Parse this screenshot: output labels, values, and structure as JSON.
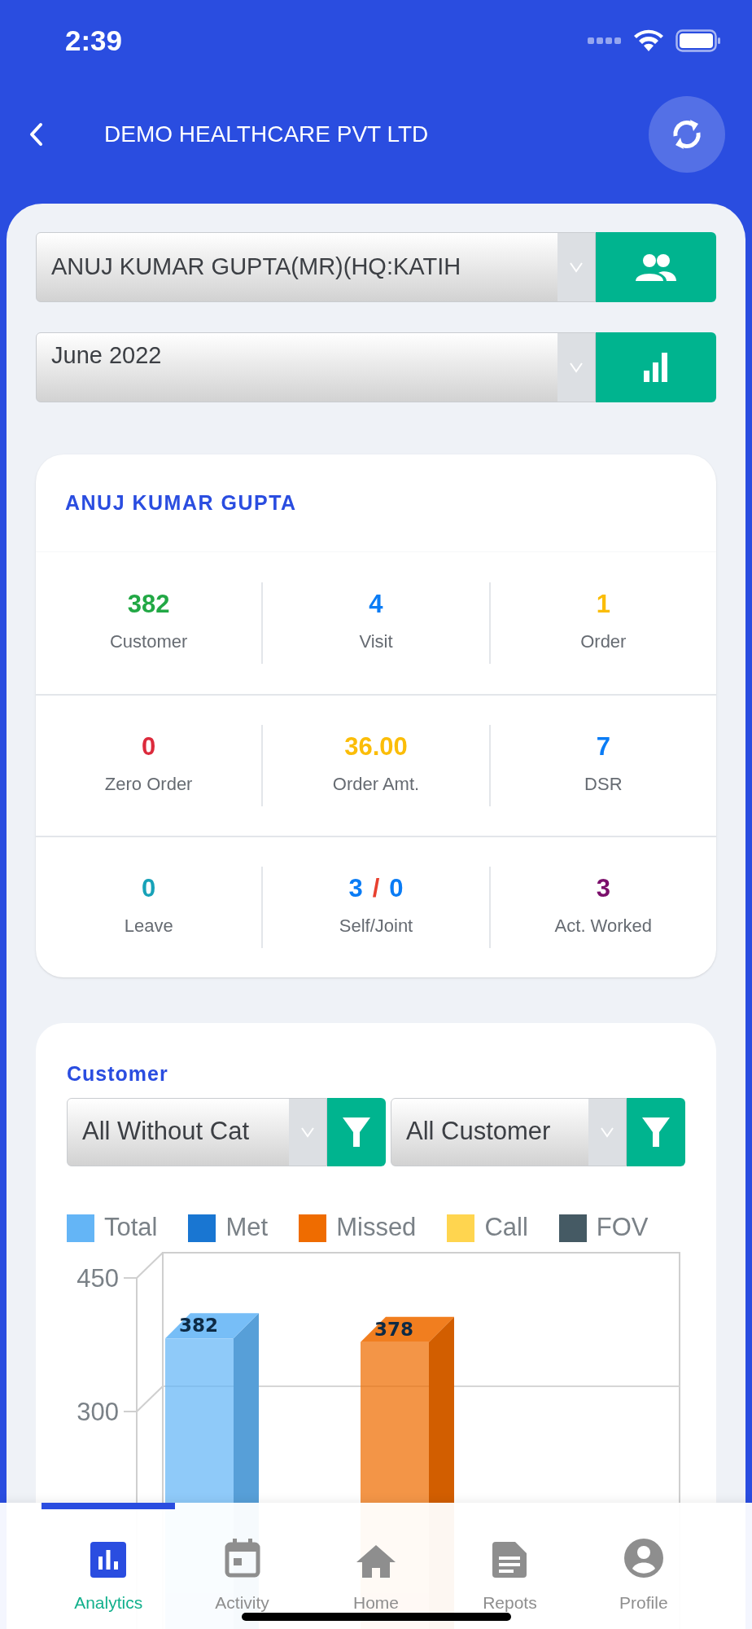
{
  "status_bar": {
    "time": "2:39"
  },
  "header": {
    "title": "DEMO HEALTHCARE PVT LTD"
  },
  "selectors": [
    {
      "value": "ANUJ KUMAR GUPTA(MR)(HQ:KATIH"
    },
    {
      "value": "June 2022"
    }
  ],
  "summary_card": {
    "title": "ANUJ KUMAR GUPTA",
    "rows": [
      [
        {
          "parts": [
            {
              "text": "382",
              "color": "#22a845"
            }
          ],
          "label": "Customer"
        },
        {
          "parts": [
            {
              "text": "4",
              "color": "#0a7cf5"
            }
          ],
          "label": "Visit"
        },
        {
          "parts": [
            {
              "text": "1",
              "color": "#fbbd08"
            }
          ],
          "label": "Order"
        }
      ],
      [
        {
          "parts": [
            {
              "text": "0",
              "color": "#dc2a3c"
            }
          ],
          "label": "Zero Order"
        },
        {
          "parts": [
            {
              "text": "36.00",
              "color": "#fbbd08"
            }
          ],
          "label": "Order Amt."
        },
        {
          "parts": [
            {
              "text": "7",
              "color": "#0a7cf5"
            }
          ],
          "label": "DSR"
        }
      ],
      [
        {
          "parts": [
            {
              "text": "0",
              "color": "#17a2b8"
            }
          ],
          "label": "Leave"
        },
        {
          "parts": [
            {
              "text": "3",
              "color": "#0a7cf5"
            },
            {
              "text": "/",
              "color": "#e8402f"
            },
            {
              "text": "0",
              "color": "#0a7cf5"
            }
          ],
          "label": "Self/Joint"
        },
        {
          "parts": [
            {
              "text": "3",
              "color": "#7b0f6b"
            }
          ],
          "label": "Act. Worked"
        }
      ]
    ]
  },
  "customer_card": {
    "title": "Customer",
    "filters": [
      {
        "value": "All Without Cat"
      },
      {
        "value": "All Customer"
      }
    ],
    "chart_data": {
      "type": "bar",
      "series": [
        {
          "name": "Total",
          "color": "#64b5f6",
          "values": [
            382
          ]
        },
        {
          "name": "Met",
          "color": "#1976d2",
          "values": [
            null
          ]
        },
        {
          "name": "Missed",
          "color": "#ef6c00",
          "values": [
            378
          ]
        },
        {
          "name": "Call",
          "color": "#ffd54f",
          "values": [
            null
          ]
        },
        {
          "name": "FOV",
          "color": "#455a64",
          "values": [
            null
          ]
        }
      ],
      "ylim": [
        0,
        450
      ],
      "yticks": [
        300,
        450
      ],
      "stacked": false,
      "data_labels": true
    }
  },
  "bottom_nav": [
    {
      "label": "Analytics",
      "selected": true
    },
    {
      "label": "Activity",
      "selected": false
    },
    {
      "label": "Home",
      "selected": false
    },
    {
      "label": "Repots",
      "selected": false
    },
    {
      "label": "Profile",
      "selected": false
    }
  ]
}
